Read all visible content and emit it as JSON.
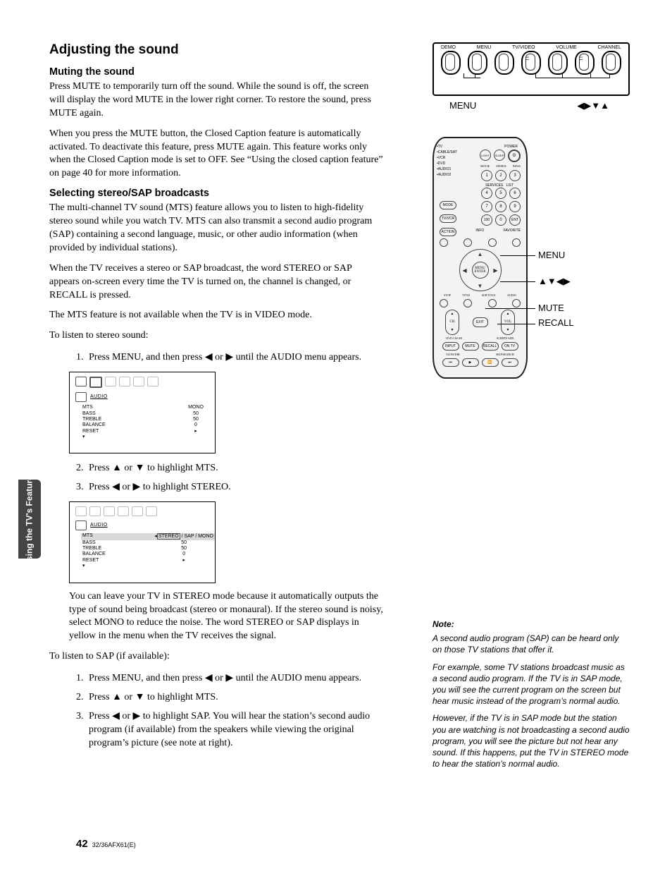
{
  "tab": "Using the TV's\nFeatures",
  "h1": "Adjusting the sound",
  "sec1": {
    "h2": "Muting the sound",
    "p1": "Press MUTE to temporarily turn off the sound. While the sound is off, the screen will display the word MUTE in the lower right corner. To restore the sound, press MUTE again.",
    "p2": "When you press the MUTE button, the Closed Caption feature is automatically activated. To deactivate this feature, press MUTE again. This feature works only when the Closed Caption mode is set to OFF. See “Using the closed caption feature” on page 40 for more information."
  },
  "sec2": {
    "h2": "Selecting stereo/SAP broadcasts",
    "p1": "The multi-channel TV sound (MTS) feature allows you to listen to high-fidelity stereo sound while you watch TV. MTS can also transmit a second audio program (SAP) containing a second language, music, or other audio information (when provided by individual stations).",
    "p2": "When the TV receives a stereo or SAP broadcast, the word STEREO or SAP appears on-screen every time the TV is turned on, the channel is changed, or RECALL is pressed.",
    "p3": "The MTS feature is not available when the TV is in VIDEO mode.",
    "p4": "To listen to stereo sound:",
    "step1a": "Press MENU, and then press ",
    "step1b": " or ",
    "step1c": " until the AUDIO menu appears.",
    "step2a": "Press ",
    "step2b": " or ",
    "step2c": " to highlight MTS.",
    "step3a": "Press ",
    "step3b": " or ",
    "step3c": " to highlight STEREO.",
    "p5": "You can leave your TV in STEREO mode because it automatically outputs the type of sound being broadcast (stereo or monaural). If the stereo sound is noisy, select MONO to reduce the noise. The word STEREO or SAP displays in yellow in the menu when the TV receives the signal.",
    "p6": "To listen to SAP (if available):",
    "sap1a": "Press MENU, and then press ",
    "sap1b": " or ",
    "sap1c": " until the AUDIO menu appears.",
    "sap2a": "Press ",
    "sap2b": " or ",
    "sap2c": " to highlight MTS.",
    "sap3a": "Press ",
    "sap3b": " or ",
    "sap3c": " to highlight SAP. You will hear the station’s second audio program (if available) from the speakers while viewing the original program’s picture (see note at right)."
  },
  "osd1": {
    "label": "AUDIO",
    "rows": [
      {
        "k": "MTS",
        "v": "MONO"
      },
      {
        "k": "BASS",
        "v": "50"
      },
      {
        "k": "TREBLE",
        "v": "50"
      },
      {
        "k": "BALANCE",
        "v": "0"
      },
      {
        "k": "RESET",
        "v": "▸"
      }
    ],
    "more": "▾"
  },
  "osd2": {
    "label": "AUDIO",
    "mts_opts": "STEREO  / SAP / MONO",
    "rows": [
      {
        "k": "BASS",
        "v": "50"
      },
      {
        "k": "TREBLE",
        "v": "50"
      },
      {
        "k": "BALANCE",
        "v": "0"
      },
      {
        "k": "RESET",
        "v": "▸"
      }
    ],
    "mts": "MTS",
    "more": "▾"
  },
  "panel": {
    "labels": [
      "DEMO",
      "MENU",
      "TV/VIDEO",
      "VOLUME",
      "CHANNEL"
    ],
    "out1": "MENU",
    "out2": "◀▶▼▲"
  },
  "remote": {
    "side": [
      "•TV",
      "•CABLE/SAT",
      "•VCR",
      "•DVD",
      "•AUDIO1",
      "•AUDIO2"
    ],
    "mode": "MODE",
    "tvvcr": "TV/VCR",
    "action": "ACTION",
    "top": [
      "LIGHT",
      "SLEEP",
      "⏼"
    ],
    "top2": [
      "MOVIE",
      "SPORTS",
      "NEWS"
    ],
    "num": [
      "1",
      "2",
      "3",
      "4",
      "5",
      "6",
      "7",
      "8",
      "9",
      "100",
      "0",
      "ENT"
    ],
    "midlabels": [
      "SERVICES",
      "LIST"
    ],
    "info": "INFO",
    "fav": "FAVORITE",
    "dpad": "MENU\nENTER",
    "stop": "STOP",
    "title": "TITLE",
    "sub": "SUB TITLE",
    "audio": "AUDIO",
    "ch": "CH",
    "vol": "VOL",
    "exit": "EXIT",
    "bottom1": [
      "INPUT",
      "MUTE",
      "RECALL",
      "ON TV"
    ],
    "bottom1a": [
      "",
      "",
      "",
      "––"
    ],
    "dvd": "DVD CLEAR",
    "screen": "SCREEN\nSIZE",
    "slow": "SLOW/DIR",
    "skip": "SKIP/SEARCH",
    "trans": [
      "⏮",
      "▶",
      "⏩",
      "⏭"
    ],
    "callouts": [
      "MENU",
      "▲▼◀▶",
      "MUTE",
      "RECALL"
    ]
  },
  "note": {
    "h": "Note:",
    "p1": "A second audio program (SAP) can be heard only on those TV stations that offer it.",
    "p2": "For example, some TV stations broadcast music as a second audio program. If the TV is in SAP mode, you will see the current program on the screen but hear music instead of the program’s normal audio.",
    "p3": "However, if the TV is in SAP mode but the station you are watching is not broadcasting a second audio program, you will see the picture but not hear any sound. If this happens, put the TV in STEREO mode to hear the station’s normal audio."
  },
  "footer": {
    "page": "42",
    "model": "32/36AFX61(E)"
  }
}
